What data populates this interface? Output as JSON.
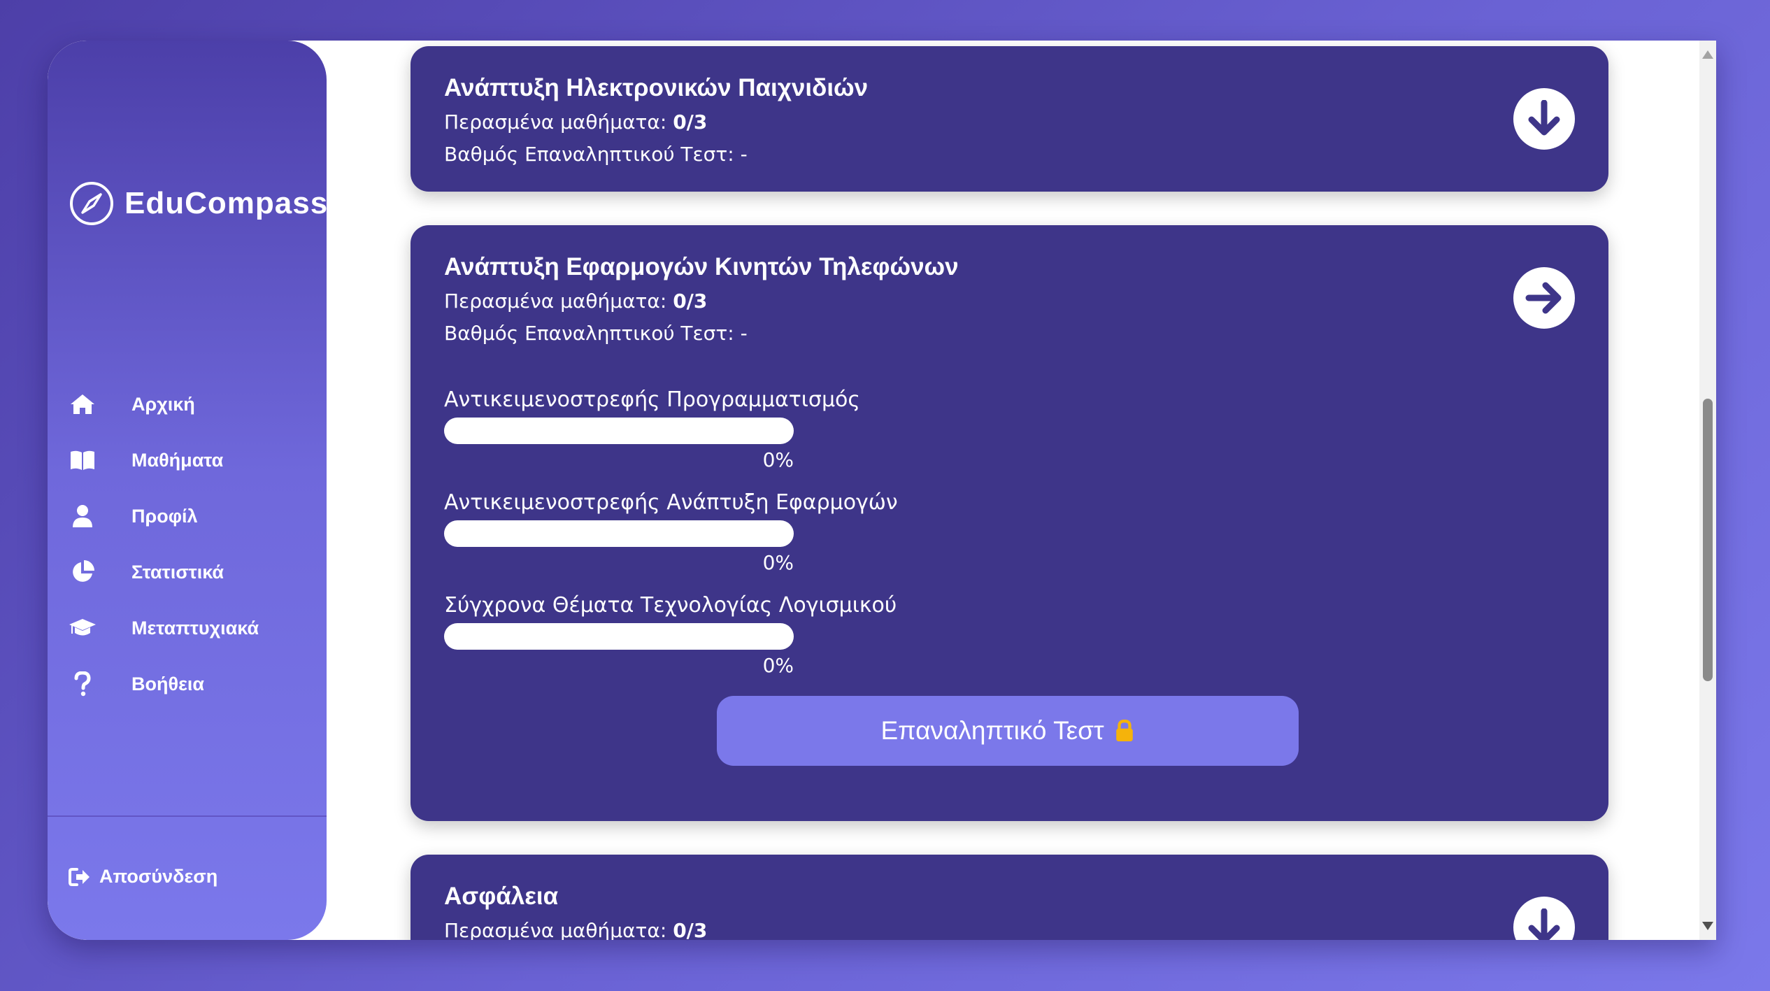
{
  "sidebar": {
    "brand": "EduCompass",
    "nav": [
      {
        "label": "Αρχική",
        "icon": "home-icon"
      },
      {
        "label": "Μαθήματα",
        "icon": "book-icon"
      },
      {
        "label": "Προφίλ",
        "icon": "user-icon"
      },
      {
        "label": "Στατιστικά",
        "icon": "pie-chart-icon"
      },
      {
        "label": "Μεταπτυχιακά",
        "icon": "graduation-cap-icon"
      },
      {
        "label": "Βοήθεια",
        "icon": "question-icon"
      }
    ],
    "logout": "Αποσύνδεση"
  },
  "cards": [
    {
      "title": "Ανάπτυξη Ηλεκτρονικών Παιχνιδιών",
      "passed_label": "Περασμένα μαθήματα:",
      "passed_value": "0/3",
      "grade_label": "Βαθμός Επαναληπτικού Τεστ:",
      "grade_value": "-",
      "toggle_icon": "arrow-down-icon"
    },
    {
      "title": "Ανάπτυξη Εφαρμογών Κινητών Τηλεφώνων",
      "passed_label": "Περασμένα μαθήματα:",
      "passed_value": "0/3",
      "grade_label": "Βαθμός Επαναληπτικού Τεστ:",
      "grade_value": "-",
      "toggle_icon": "arrow-right-icon",
      "lessons": [
        {
          "name": "Αντικειμενοστρεφής Προγραμματισμός",
          "locked": false,
          "progress": 0,
          "percent": "0%"
        },
        {
          "name": "Αντικειμενοστρεφής Ανάπτυξη Εφαρμογών",
          "locked": true,
          "progress": 0,
          "percent": "0%"
        },
        {
          "name": "Σύγχρονα Θέματα Τεχνολογίας Λογισμικού",
          "locked": true,
          "progress": 0,
          "percent": "0%"
        }
      ],
      "test_button": "Επαναληπτικό Τεστ"
    },
    {
      "title": "Ασφάλεια",
      "passed_label": "Περασμένα μαθήματα:",
      "passed_value": "0/3",
      "toggle_icon": "arrow-down-icon"
    }
  ],
  "colors": {
    "card_bg": "#3e3589",
    "accent": "#7b78ea",
    "lock": "#f5b30b"
  }
}
